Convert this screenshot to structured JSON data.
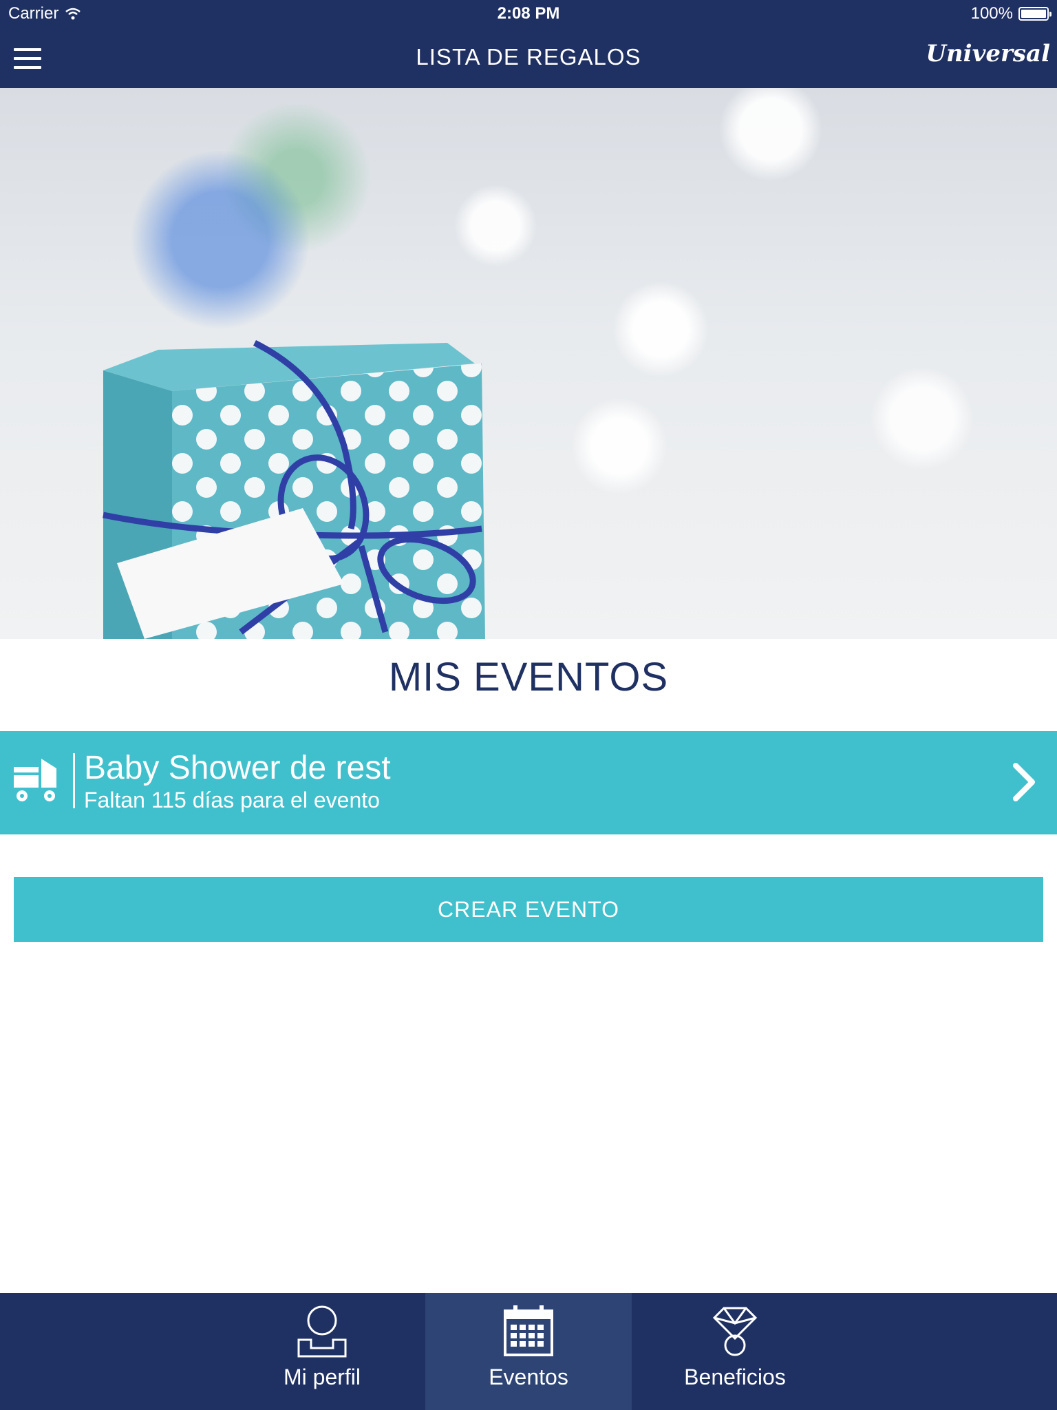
{
  "status_bar": {
    "carrier": "Carrier",
    "time": "2:08 PM",
    "battery": "100%"
  },
  "nav": {
    "title": "LISTA DE REGALOS",
    "brand": "Universal"
  },
  "section": {
    "title": "MIS EVENTOS"
  },
  "event": {
    "name": "Baby Shower de rest",
    "countdown": "Faltan 115 días para el evento"
  },
  "create_button": {
    "label": "CREAR EVENTO"
  },
  "tabs": [
    {
      "label": "Mi perfil",
      "icon": "profile-icon",
      "active": false
    },
    {
      "label": "Eventos",
      "icon": "calendar-icon",
      "active": true
    },
    {
      "label": "Beneficios",
      "icon": "medal-icon",
      "active": false
    }
  ],
  "colors": {
    "navy": "#1f3062",
    "teal": "#40c0cd",
    "tab_active": "#2d4474"
  }
}
